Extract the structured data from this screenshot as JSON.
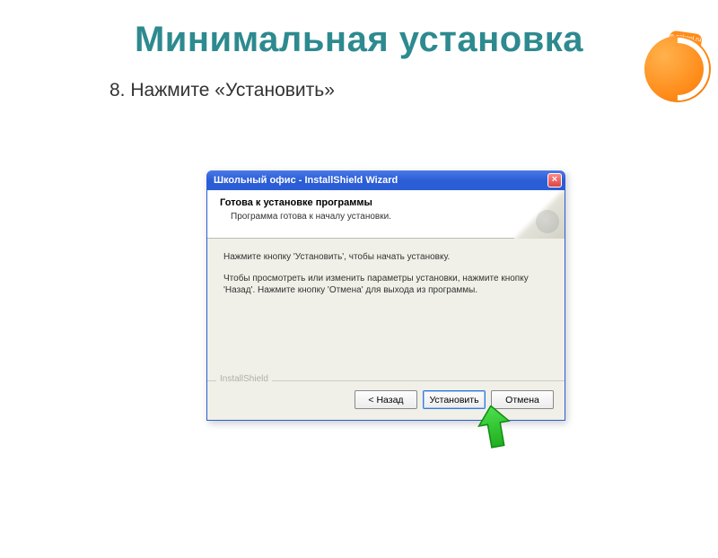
{
  "slide": {
    "title": "Минимальная установка",
    "step": "8. Нажмите «Установить»"
  },
  "logo": {
    "tab": "e-school.ru"
  },
  "dialog": {
    "titlebar": "Школьный офис - InstallShield Wizard",
    "header_title": "Готова к установке программы",
    "header_sub": "Программа готова к началу установки.",
    "body_line1": "Нажмите кнопку 'Установить', чтобы начать установку.",
    "body_line2": "Чтобы просмотреть или изменить параметры установки, нажмите кнопку 'Назад'. Нажмите кнопку 'Отмена' для выхода из программы.",
    "brand": "InstallShield",
    "buttons": {
      "back": "< Назад",
      "install": "Установить",
      "cancel": "Отмена"
    }
  }
}
